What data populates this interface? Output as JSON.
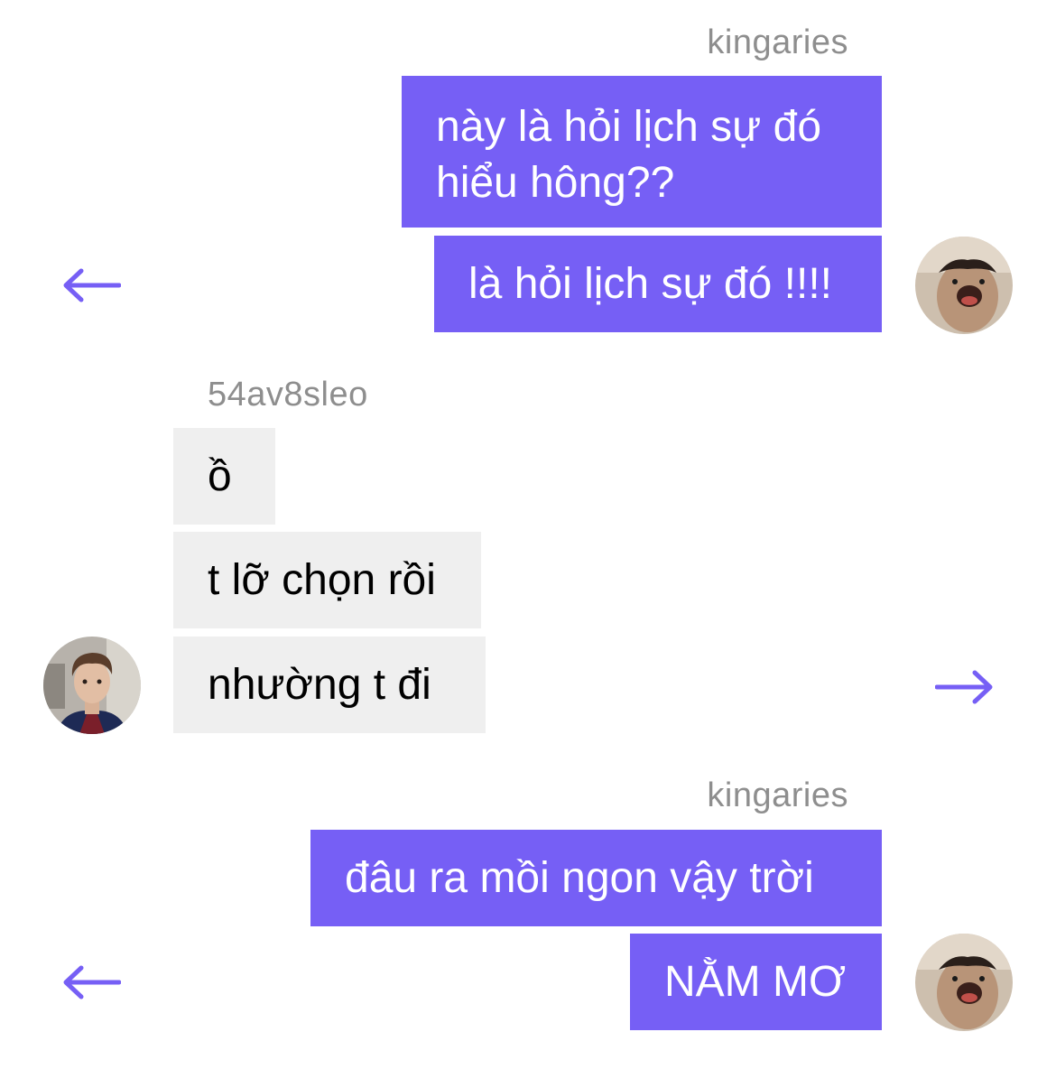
{
  "accent_color": "#765ff5",
  "incoming_bubble_color": "#efefef",
  "sender_name_color": "#8e8e8e",
  "groups": [
    {
      "sender": "kingaries",
      "direction": "outgoing",
      "messages": [
        {
          "lines": [
            "này là hỏi lịch sự đó",
            "hiểu hông??"
          ]
        },
        {
          "text": "là hỏi lịch sự đó !!!!"
        }
      ],
      "avatar_icon": "meme-avatar-icon",
      "action_icon": "arrow-left-icon"
    },
    {
      "sender": "54av8sleo",
      "direction": "incoming",
      "messages": [
        {
          "text": "ồ"
        },
        {
          "text": "t lỡ chọn rồi"
        },
        {
          "text": "nhường t đi"
        }
      ],
      "avatar_icon": "user-photo-avatar-icon",
      "action_icon": "arrow-right-icon"
    },
    {
      "sender": "kingaries",
      "direction": "outgoing",
      "messages": [
        {
          "text": "đâu ra mồi ngon vậy trời"
        },
        {
          "text": "NẰM MƠ"
        }
      ],
      "avatar_icon": "meme-avatar-icon",
      "action_icon": "arrow-left-icon"
    }
  ]
}
